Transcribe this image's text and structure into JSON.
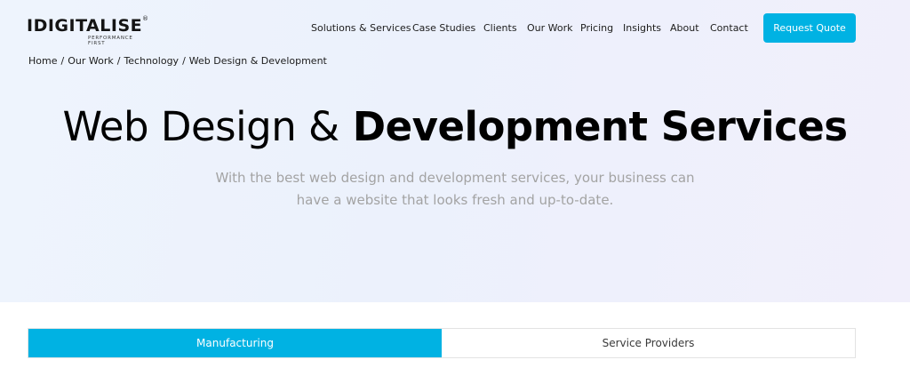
{
  "logo": {
    "name": "IDIGITALISE",
    "registered": "®",
    "tagline": "PERFORMANCE FIRST"
  },
  "nav": {
    "items": [
      "Solutions & Services",
      "Case Studies",
      "Clients",
      "Our Work",
      "Pricing",
      "Insights",
      "About",
      "Contact"
    ],
    "cta": "Request Quote"
  },
  "breadcrumb": {
    "items": [
      "Home",
      "Our Work",
      "Technology",
      "Web Design & Development"
    ],
    "separator": "/"
  },
  "hero": {
    "title_light": "Web Design &",
    "title_bold": "Development Services",
    "subtitle_line1": "With the best web design and development services, your business can",
    "subtitle_line2": "have a website that looks fresh and up-to-date."
  },
  "tabs": {
    "items": [
      "Manufacturing",
      "Service Providers"
    ],
    "active": "Manufacturing"
  },
  "colors": {
    "accent": "#00b2e3",
    "text": "#1c1c1c",
    "muted": "#a3a3a3"
  }
}
